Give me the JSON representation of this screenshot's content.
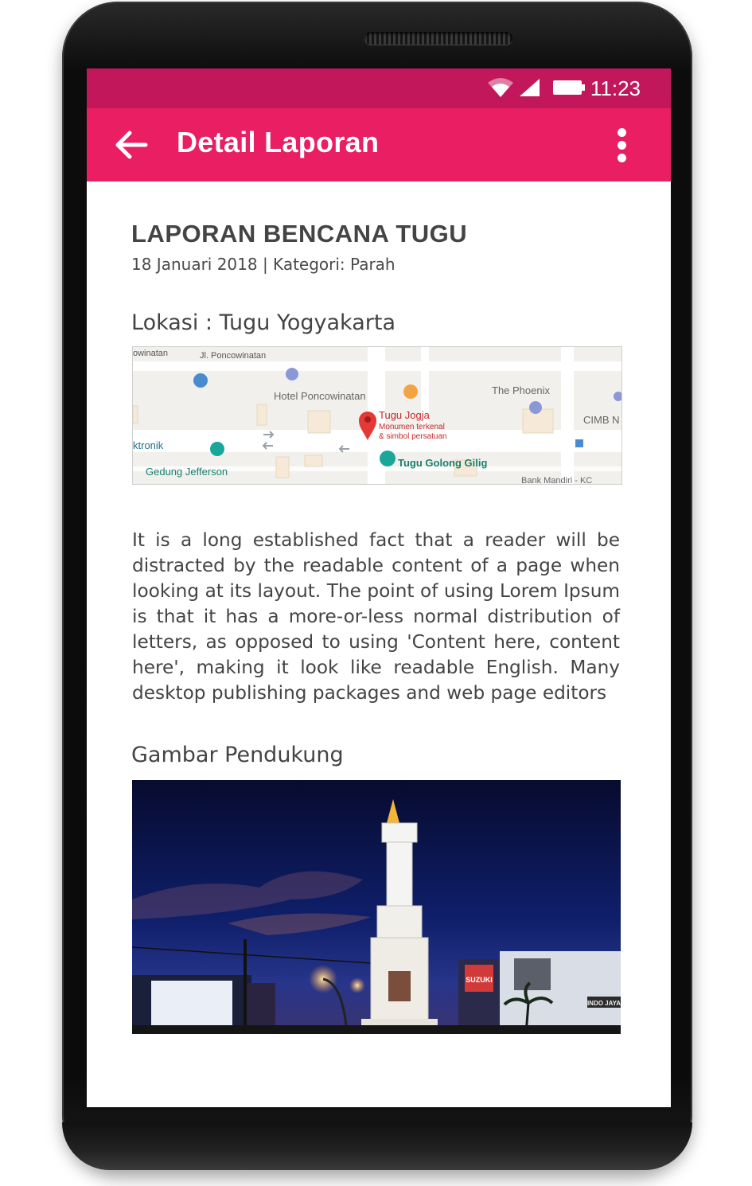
{
  "status_bar": {
    "time": "11:23",
    "icons": [
      "wifi-icon",
      "signal-icon",
      "battery-icon"
    ]
  },
  "app_bar": {
    "title": "Detail Laporan",
    "back_icon": "arrow-back-icon",
    "menu_icon": "more-vert-icon",
    "color": "#e91e63",
    "status_color": "#c2185b"
  },
  "report": {
    "title": "LAPORAN BENCANA TUGU",
    "meta": "18 Januari 2018 | Kategori: Parah",
    "location_label": "Lokasi : Tugu Yogyakarta",
    "description": "It is a long established fact that a reader will be distracted by the readable content of a page when looking at its layout. The point of using Lorem Ipsum is that it has a more-or-less normal distribution of letters, as opposed to using 'Content here, content here', making it look like readable English. Many desktop publishing packages and web page editors",
    "image_label": "Gambar Pendukung"
  },
  "map": {
    "labels": {
      "street_1": "owinatan",
      "street_2": "Jl. Poncowinatan",
      "hotel": "Hotel Poncowinatan",
      "phoenix": "The Phoenix",
      "cimb": "CIMB N",
      "tugu_name": "Tugu Jogja",
      "tugu_desc_1": "Monumen terkenal",
      "tugu_desc_2": "& simbol persatuan",
      "elektronik": "ktronik",
      "jefferson": "Gedung Jefferson",
      "golong": "Tugu Golong Gilig",
      "bank": "Bank Mandiri - KC"
    }
  },
  "photo": {
    "signs": {
      "suzuki": "SUZUKI",
      "indo": "INDO JAYA"
    }
  }
}
